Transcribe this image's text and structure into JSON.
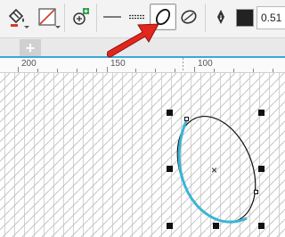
{
  "toolbar": {
    "outline_width_value": "0.51",
    "buttons": {
      "fill": "fill-icon",
      "no_outline": "no-outline-icon",
      "add_color": "add-color-icon",
      "solid_line": "solid-line-icon",
      "dashed_line": "dashed-line-icon",
      "ellipse_selected": "ellipse-icon",
      "pie": "pie-icon",
      "pen": "pen-nib-icon"
    },
    "outline_color": "#222222"
  },
  "tabs": {
    "add_label": "+"
  },
  "ruler": {
    "labels": [
      "200",
      "150",
      "100"
    ]
  },
  "canvas": {
    "accent_color": "#3ab4d6",
    "arrow_color": "#e3261e"
  }
}
